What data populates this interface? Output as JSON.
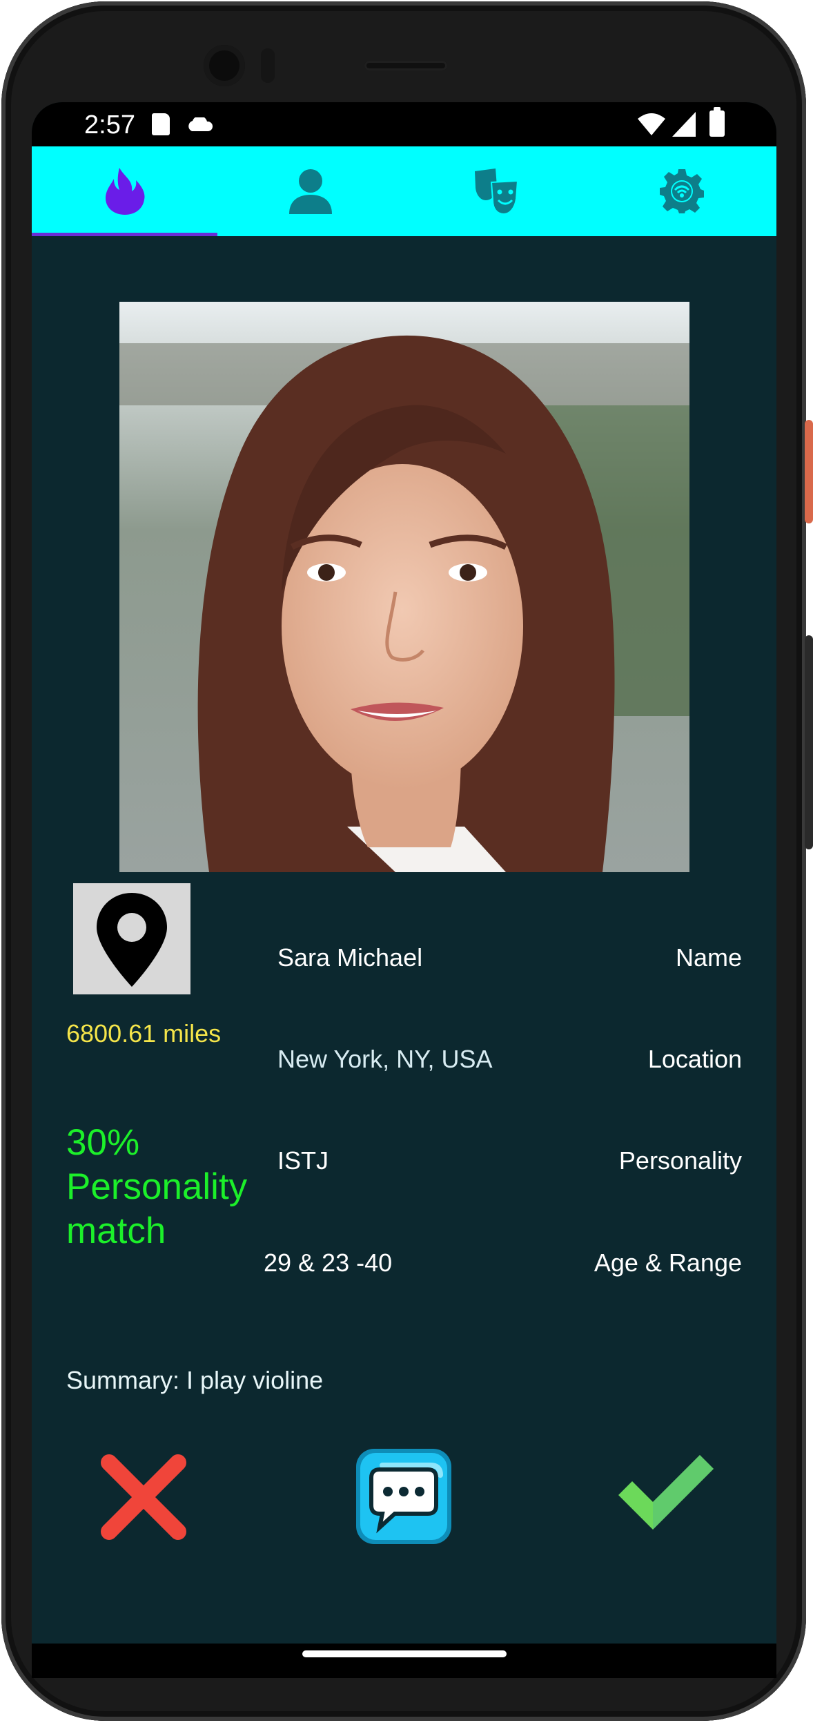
{
  "status_bar": {
    "time": "2:57"
  },
  "tabs": [
    {
      "name": "discover",
      "icon": "flame-icon",
      "active": true
    },
    {
      "name": "profile",
      "icon": "person-icon",
      "active": false
    },
    {
      "name": "personality",
      "icon": "theater-masks-icon",
      "active": false
    },
    {
      "name": "settings",
      "icon": "settings-gear-icon",
      "active": false
    }
  ],
  "profile": {
    "photo_icon": "profile-photo",
    "distance": "6800.61 miles",
    "match": "30% Personality match",
    "rows": [
      {
        "value": "Sara Michael",
        "label": "Name"
      },
      {
        "value": "New York, NY, USA",
        "label": "Location"
      },
      {
        "value": "ISTJ",
        "label": "Personality"
      },
      {
        "value": "29 & 23 -40",
        "label": "Age & Range"
      }
    ],
    "summary": "Summary: I play violine"
  },
  "actions": [
    {
      "name": "reject",
      "icon": "x-icon",
      "color": "#f0453a"
    },
    {
      "name": "message",
      "icon": "chat-bubble-icon",
      "color": "#1ec3f2"
    },
    {
      "name": "like",
      "icon": "checkmark-icon",
      "color": "#6cd95a"
    }
  ],
  "colors": {
    "accent": "#00ffff",
    "background": "#0c282f",
    "distance": "#f5e54a",
    "match": "#1cf02a"
  }
}
